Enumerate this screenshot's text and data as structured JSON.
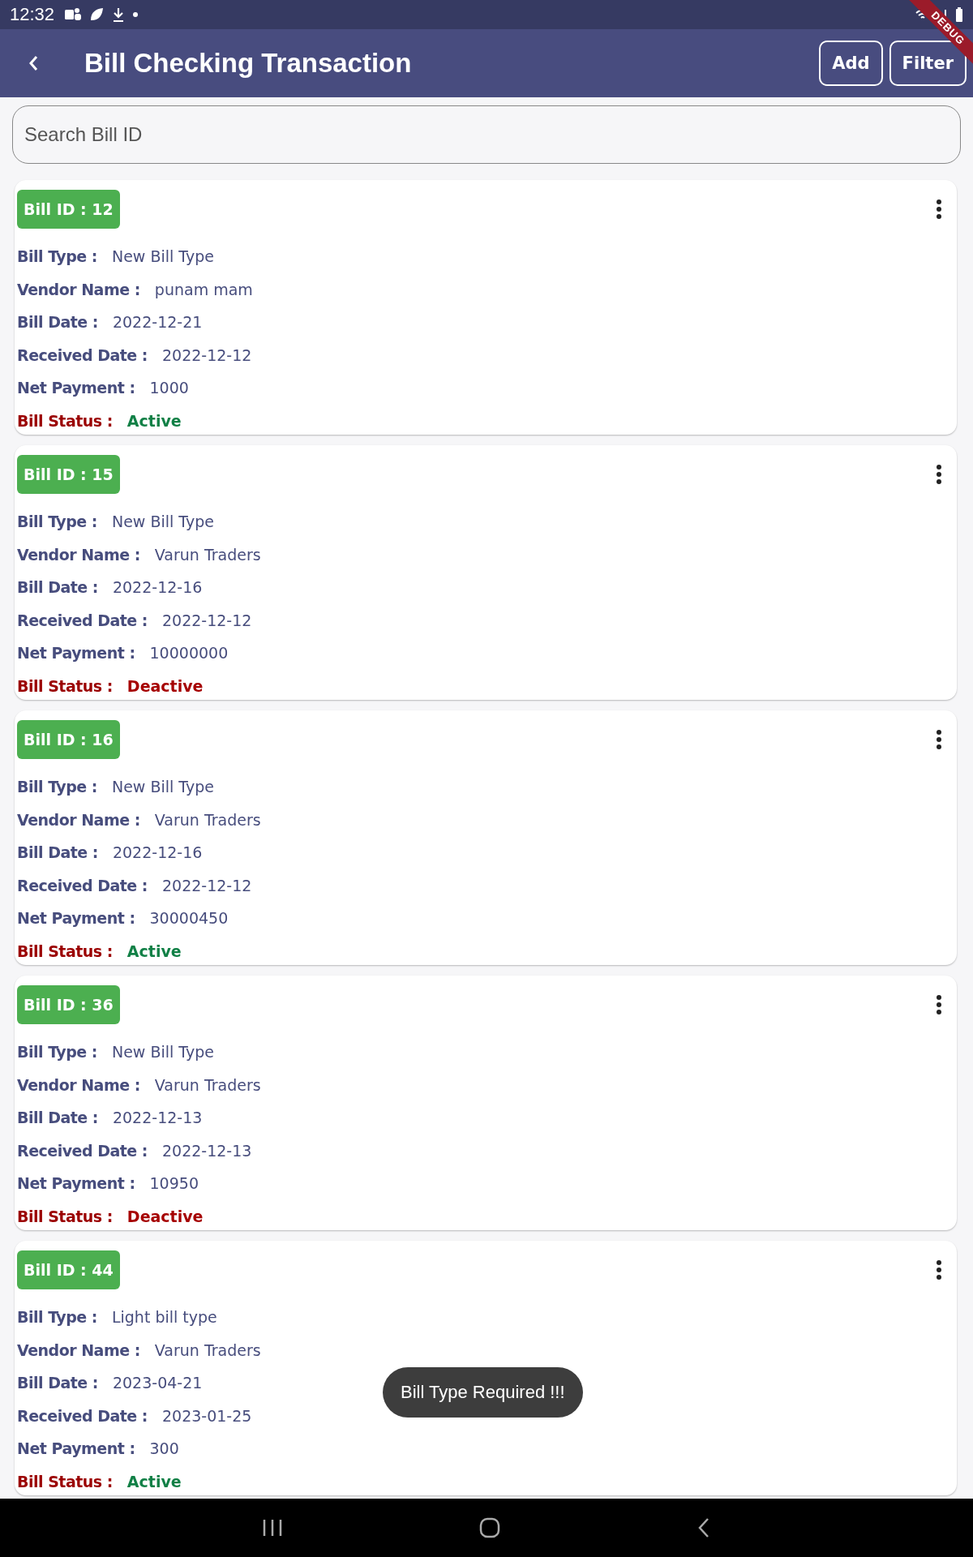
{
  "status_bar": {
    "time": "12:32"
  },
  "debug_banner": "DEBUG",
  "app_bar": {
    "title": "Bill Checking Transaction",
    "buttons": [
      "Add",
      "Filter"
    ]
  },
  "search": {
    "placeholder": "Search Bill ID"
  },
  "bills": [
    {
      "badge": "Bill ID : 12",
      "fields": [
        {
          "label": "Bill Type :",
          "value": "New Bill Type"
        },
        {
          "label": "Vendor Name :",
          "value": "punam mam"
        },
        {
          "label": "Bill Date :",
          "value": "2022-12-21"
        },
        {
          "label": "Received Date :",
          "value": "2022-12-12"
        },
        {
          "label": "Net Payment :",
          "value": "1000"
        }
      ],
      "status_label": "Bill Status :",
      "bill_status": "Active",
      "active": true
    },
    {
      "badge": "Bill ID : 15",
      "fields": [
        {
          "label": "Bill Type :",
          "value": "New Bill Type"
        },
        {
          "label": "Vendor Name :",
          "value": "Varun Traders"
        },
        {
          "label": "Bill Date :",
          "value": "2022-12-16"
        },
        {
          "label": "Received Date :",
          "value": "2022-12-12"
        },
        {
          "label": "Net Payment :",
          "value": "10000000"
        }
      ],
      "status_label": "Bill Status :",
      "bill_status": "Deactive",
      "active": false
    },
    {
      "badge": "Bill ID : 16",
      "fields": [
        {
          "label": "Bill Type :",
          "value": "New Bill Type"
        },
        {
          "label": "Vendor Name :",
          "value": "Varun Traders"
        },
        {
          "label": "Bill Date :",
          "value": "2022-12-16"
        },
        {
          "label": "Received Date :",
          "value": "2022-12-12"
        },
        {
          "label": "Net Payment :",
          "value": "30000450"
        }
      ],
      "status_label": "Bill Status :",
      "bill_status": "Active",
      "active": true
    },
    {
      "badge": "Bill ID : 36",
      "fields": [
        {
          "label": "Bill Type :",
          "value": "New Bill Type"
        },
        {
          "label": "Vendor Name :",
          "value": "Varun Traders"
        },
        {
          "label": "Bill Date :",
          "value": "2022-12-13"
        },
        {
          "label": "Received Date :",
          "value": "2022-12-13"
        },
        {
          "label": "Net Payment :",
          "value": "10950"
        }
      ],
      "status_label": "Bill Status :",
      "bill_status": "Deactive",
      "active": false
    },
    {
      "badge": "Bill ID : 44",
      "fields": [
        {
          "label": "Bill Type :",
          "value": "Light bill type"
        },
        {
          "label": "Vendor Name :",
          "value": "Varun Traders"
        },
        {
          "label": "Bill Date :",
          "value": "2023-04-21"
        },
        {
          "label": "Received Date :",
          "value": "2023-01-25"
        },
        {
          "label": "Net Payment :",
          "value": "300"
        }
      ],
      "status_label": "Bill Status :",
      "bill_status": "Active",
      "active": true
    }
  ],
  "toast": "Bill Type Required !!!"
}
